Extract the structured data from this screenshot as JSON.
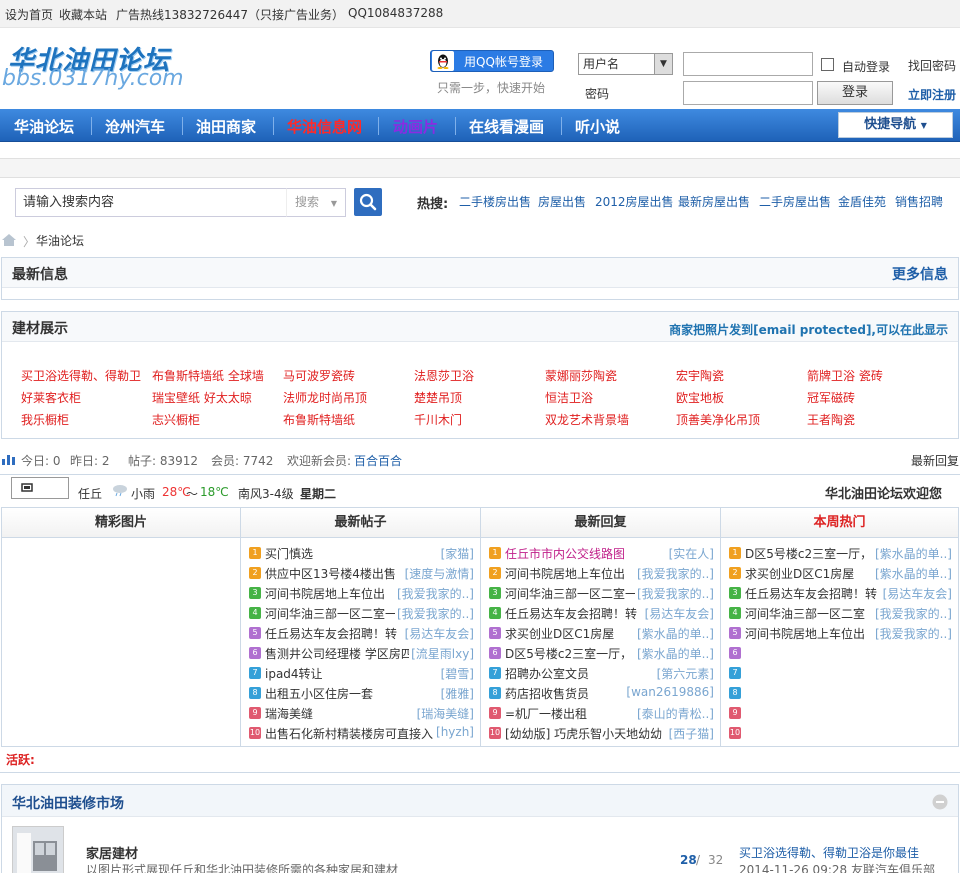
{
  "topbar": {
    "set_home": "设为首页",
    "bookmark": "收藏本站",
    "ad_hotline": "广告热线13832726447（只接广告业务）",
    "qq": "QQ1084837288"
  },
  "header": {
    "logo_text": "华北油田论坛",
    "logo_url": "bbs.0317hy.com",
    "qq_login": "用QQ帐号登录",
    "qq_tip": "只需一步，快速开始",
    "username_select": "用户名",
    "password_label": "密码",
    "auto_login": "自动登录",
    "login_button": "登录",
    "find_password": "找回密码",
    "register": "立即注册"
  },
  "nav": {
    "items": [
      {
        "label": "华油论坛",
        "color": "#ffffff"
      },
      {
        "label": "沧州汽车",
        "color": "#ffffff"
      },
      {
        "label": "油田商家",
        "color": "#ffffff"
      },
      {
        "label": "华油信息网",
        "color": "#ff2a2a"
      },
      {
        "label": "动画片",
        "color": "#8a2be2"
      },
      {
        "label": "在线看漫画",
        "color": "#ffffff"
      },
      {
        "label": "听小说",
        "color": "#ffffff"
      }
    ],
    "quick_nav": "快捷导航"
  },
  "search": {
    "placeholder": "请输入搜索内容",
    "type": "搜索",
    "hot_label": "热搜:",
    "hot": [
      "二手楼房出售",
      "房屋出售",
      "2012房屋出售",
      "最新房屋出售",
      "二手房屋出售",
      "金盾佳苑",
      "销售招聘"
    ]
  },
  "breadcrumb": {
    "current": "华油论坛"
  },
  "latest_info": {
    "title": "最新信息",
    "more": "更多信息"
  },
  "building": {
    "title": "建材展示",
    "note": "商家把照片发到[email protected],可以在此显示",
    "items": [
      "买卫浴选得勒、得勒卫",
      "布鲁斯特墙纸 全球墙",
      "马可波罗瓷砖",
      "法恩莎卫浴",
      "蒙娜丽莎陶瓷",
      "宏宇陶瓷",
      "箭牌卫浴 瓷砖",
      "好莱客衣柜",
      "瑞宝壁纸 好太太晾",
      "法师龙时尚吊顶",
      "楚楚吊顶",
      "恒洁卫浴",
      "欧宝地板",
      "冠军磁砖",
      "我乐橱柜",
      "志兴橱柜",
      "布鲁斯特墙纸",
      "千川木门",
      "双龙艺术背景墙",
      "顶善美净化吊顶",
      "王者陶瓷"
    ]
  },
  "stats": {
    "today": "今日: 0",
    "yesterday": "昨日: 2",
    "posts": "帖子: 83912",
    "members": "会员: 7742",
    "welcome": "欢迎新会员:",
    "new_member": "百合百合",
    "latest_reply": "最新回复"
  },
  "weather": {
    "city": "任丘",
    "condition": "小雨",
    "temp_high": "28℃",
    "temp_sep": "～",
    "temp_low": "18℃",
    "wind": "南风3-4级",
    "weekday": "星期二",
    "welcome": "华北油田论坛欢迎您"
  },
  "columns": {
    "pics": "精彩图片",
    "latest_posts": "最新帖子",
    "latest_replies": "最新回复",
    "weekly_hot": "本周热门"
  },
  "posts": [
    {
      "title": "买门慎选",
      "author": "[家猫]"
    },
    {
      "title": "供应中区13号楼4楼出售",
      "author": "[速度与激情]"
    },
    {
      "title": "河间书院居地上车位出",
      "author": "[我爱我家的..]"
    },
    {
      "title": "河间华油三部一区二室一",
      "author": "[我爱我家的..]"
    },
    {
      "title": "任丘易达车友会招聘！转",
      "author": "[易达车友会]"
    },
    {
      "title": "售测井公司经理楼 学区房四",
      "author": "[流星雨lxy]"
    },
    {
      "title": "ipad4转让",
      "author": "[碧雪]"
    },
    {
      "title": "出租五小区住房一套",
      "author": "[雅雅]"
    },
    {
      "title": "瑞海美缝",
      "author": "[瑞海美缝]"
    },
    {
      "title": "出售石化新村精装楼房可直接入",
      "author": "[hyzh]"
    }
  ],
  "replies": [
    {
      "title": "任丘市市内公交线路图",
      "author": "[实在人]"
    },
    {
      "title": "河间书院居地上车位出",
      "author": "[我爱我家的..]"
    },
    {
      "title": "河间华油三部一区二室一",
      "author": "[我爱我家的..]"
    },
    {
      "title": "任丘易达车友会招聘！转",
      "author": "[易达车友会]"
    },
    {
      "title": "求买创业D区C1房屋",
      "author": "[紫水晶的单..]"
    },
    {
      "title": "D区5号楼c2三室一厅，",
      "author": "[紫水晶的单..]"
    },
    {
      "title": "招聘办公室文员",
      "author": "[第六元素]"
    },
    {
      "title": "药店招收售货员",
      "author": "[wan2619886]"
    },
    {
      "title": "=机厂一楼出租",
      "author": "[泰山的青松..]"
    },
    {
      "title": "[幼幼版] 巧虎乐智小天地幼幼",
      "author": "[西子猫]"
    }
  ],
  "hot": [
    {
      "title": "D区5号楼c2三室一厅，",
      "author": "[紫水晶的单..]"
    },
    {
      "title": "求买创业D区C1房屋",
      "author": "[紫水晶的单..]"
    },
    {
      "title": "任丘易达车友会招聘！转",
      "author": "[易达车友会]"
    },
    {
      "title": "河间华油三部一区二室",
      "author": "[我爱我家的..]"
    },
    {
      "title": "河间书院居地上车位出",
      "author": "[我爱我家的..]"
    },
    {
      "title": "",
      "author": ""
    },
    {
      "title": "",
      "author": ""
    },
    {
      "title": "",
      "author": ""
    },
    {
      "title": "",
      "author": ""
    },
    {
      "title": "",
      "author": ""
    }
  ],
  "num_labels": [
    "1",
    "2",
    "3",
    "4",
    "5",
    "6",
    "7",
    "8",
    "9",
    "10"
  ],
  "num_colors": [
    "#f0a020",
    "#f0a020",
    "#46b346",
    "#46b346",
    "#b070d0",
    "#b070d0",
    "#35a0d8",
    "#35a0d8",
    "#e05a70",
    "#e05a70"
  ],
  "huoyue": "活跃:",
  "market": {
    "title": "华北油田装修市场",
    "forum_name": "家居建材",
    "forum_desc": "以图片形式展现任丘和华北油田装修所需的各种家居和建材",
    "count_today": "28",
    "count_sep": " / ",
    "count_total": "32",
    "last_post": "买卫浴选得勒、得勒卫浴是你最佳",
    "last_time": "2014-11-26 09:28 友联汽车俱乐部"
  }
}
